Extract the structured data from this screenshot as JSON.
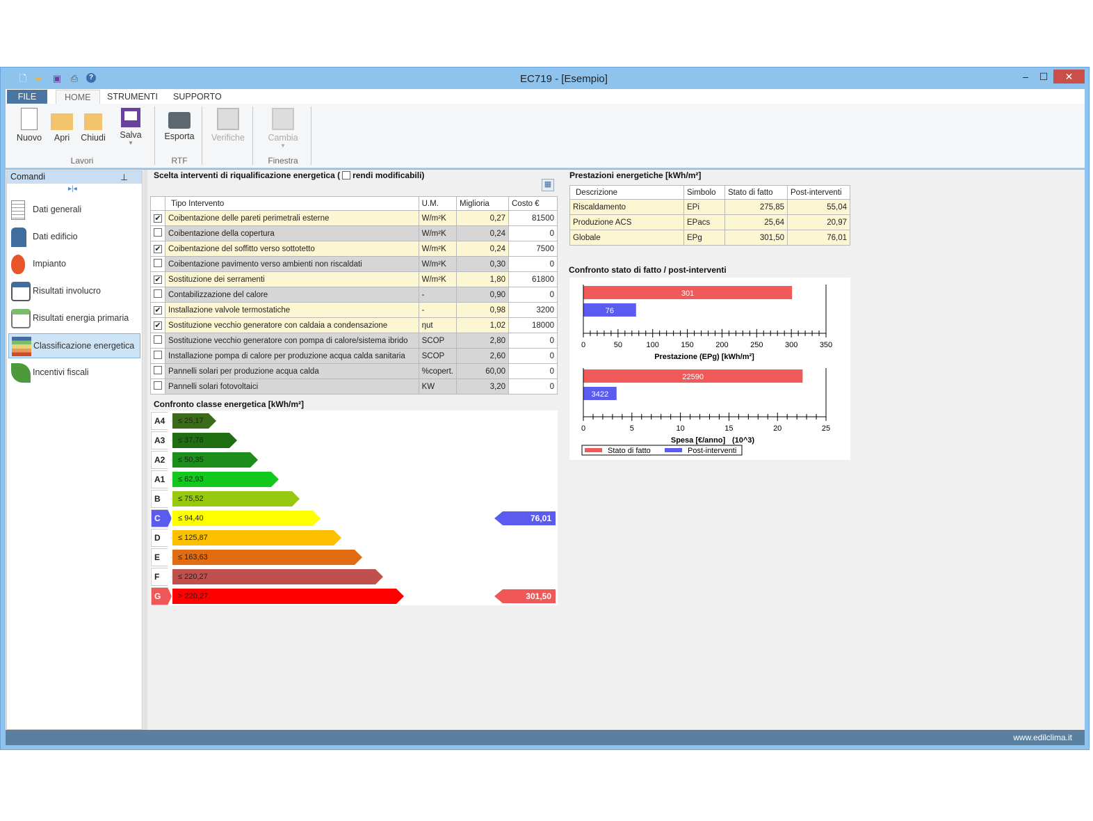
{
  "window": {
    "title": "EC719 - [Esempio]",
    "minimize": "–",
    "maximize": "☐",
    "close": "✕"
  },
  "quick_access": [
    "new-icon",
    "open-icon",
    "save-icon",
    "print-icon",
    "help-icon"
  ],
  "tabs": [
    "FILE",
    "HOME",
    "STRUMENTI",
    "SUPPORTO"
  ],
  "ribbon": {
    "buttons": [
      {
        "label": "Nuovo"
      },
      {
        "label": "Apri"
      },
      {
        "label": "Chiudi"
      },
      {
        "label": "Salva"
      },
      {
        "label": "Esporta"
      },
      {
        "label": "Verifiche"
      },
      {
        "label": "Cambia"
      }
    ],
    "groups": [
      "Lavori",
      "RTF",
      "Finestra"
    ]
  },
  "sidebar": {
    "title": "Comandi",
    "items": [
      {
        "label": "Dati generali"
      },
      {
        "label": "Dati edificio"
      },
      {
        "label": "Impianto"
      },
      {
        "label": "Risultati involucro"
      },
      {
        "label": "Risultati energia primaria"
      },
      {
        "label": "Classificazione energetica"
      },
      {
        "label": "Incentivi fiscali"
      }
    ]
  },
  "interventions": {
    "title": "Scelta interventi di riqualificazione energetica (",
    "editable_label": "rendi modificabili)",
    "columns": [
      "Tipo Intervento",
      "U.M.",
      "Miglioria",
      "Costo €"
    ],
    "rows": [
      {
        "checked": true,
        "name": "Coibentazione delle pareti perimetrali esterne",
        "um": "W/m²K",
        "miglioria": "0,27",
        "costo": "81500"
      },
      {
        "checked": false,
        "name": "Coibentazione della copertura",
        "um": "W/m²K",
        "miglioria": "0,24",
        "costo": "0"
      },
      {
        "checked": true,
        "name": "Coibentazione del soffitto verso sottotetto",
        "um": "W/m²K",
        "miglioria": "0,24",
        "costo": "7500"
      },
      {
        "checked": false,
        "name": "Coibentazione pavimento verso ambienti non riscaldati",
        "um": "W/m²K",
        "miglioria": "0,30",
        "costo": "0"
      },
      {
        "checked": true,
        "name": "Sostituzione dei serramenti",
        "um": "W/m²K",
        "miglioria": "1,80",
        "costo": "61800"
      },
      {
        "checked": false,
        "name": "Contabilizzazione del calore",
        "um": "-",
        "miglioria": "0,90",
        "costo": "0"
      },
      {
        "checked": true,
        "name": "Installazione valvole termostatiche",
        "um": "-",
        "miglioria": "0,98",
        "costo": "3200"
      },
      {
        "checked": true,
        "name": "Sostituzione vecchio generatore con caldaia a condensazione",
        "um": "ηut",
        "miglioria": "1,02",
        "costo": "18000"
      },
      {
        "checked": false,
        "name": "Sostituzione vecchio generatore con pompa di calore/sistema ibrido",
        "um": "SCOP",
        "miglioria": "2,80",
        "costo": "0"
      },
      {
        "checked": false,
        "name": "Installazione pompa di calore per produzione acqua calda sanitaria",
        "um": "SCOP",
        "miglioria": "2,60",
        "costo": "0"
      },
      {
        "checked": false,
        "name": "Pannelli solari per produzione acqua calda",
        "um": "%copert.",
        "miglioria": "60,00",
        "costo": "0"
      },
      {
        "checked": false,
        "name": "Pannelli solari fotovoltaici",
        "um": "KW",
        "miglioria": "3,20",
        "costo": "0"
      }
    ]
  },
  "energy_classes": {
    "title": "Confronto classe energetica [kWh/m²]",
    "classes": [
      {
        "label": "A4",
        "limit": "≤ 25,17",
        "color": "#3a6a1a"
      },
      {
        "label": "A3",
        "limit": "≤ 37,76",
        "color": "#1f6e12"
      },
      {
        "label": "A2",
        "limit": "≤ 50,35",
        "color": "#1c8c1a"
      },
      {
        "label": "A1",
        "limit": "≤ 62,93",
        "color": "#12c81c"
      },
      {
        "label": "B",
        "limit": "≤ 75,52",
        "color": "#95c80e"
      },
      {
        "label": "C",
        "limit": "≤ 94,40",
        "color": "#ffff00"
      },
      {
        "label": "D",
        "limit": "≤ 125,87",
        "color": "#fcc000"
      },
      {
        "label": "E",
        "limit": "≤ 163,63",
        "color": "#e26c12"
      },
      {
        "label": "F",
        "limit": "≤ 220,27",
        "color": "#c0504d"
      },
      {
        "label": "G",
        "limit": "> 220,27",
        "color": "#ff0000"
      }
    ],
    "post_value": "76,01",
    "post_class": "C",
    "post_color": "#5b5bef",
    "current_value": "301,50",
    "current_class": "G",
    "current_color": "#f05858"
  },
  "performance": {
    "title": "Prestazioni energetiche [kWh/m²]",
    "columns": [
      "Descrizione",
      "Simbolo",
      "Stato di fatto",
      "Post-interventi"
    ],
    "rows": [
      {
        "desc": "Riscaldamento",
        "sym": "EPi",
        "stato": "275,85",
        "post": "55,04"
      },
      {
        "desc": "Produzione ACS",
        "sym": "EPacs",
        "stato": "25,64",
        "post": "20,97"
      },
      {
        "desc": "Globale",
        "sym": "EPg",
        "stato": "301,50",
        "post": "76,01"
      }
    ]
  },
  "comparison_title": "Confronto stato di fatto / post-interventi",
  "chart_data": [
    {
      "type": "bar",
      "orientation": "horizontal",
      "xlabel": "Prestazione (EPg) [kWh/m²]",
      "xlim": [
        0,
        350
      ],
      "ticks": [
        0,
        50,
        100,
        150,
        200,
        250,
        300,
        350
      ],
      "minor_step": 10,
      "series": [
        {
          "name": "Stato di fatto",
          "value": 301,
          "label": "301",
          "color": "#f05a5a"
        },
        {
          "name": "Post-interventi",
          "value": 76,
          "label": "76",
          "color": "#5b5bef"
        }
      ]
    },
    {
      "type": "bar",
      "orientation": "horizontal",
      "xlabel": "Spesa [€/anno]",
      "xlabel_unit": "(10^3)",
      "xlim": [
        0,
        25
      ],
      "ticks": [
        0,
        5,
        10,
        15,
        20,
        25
      ],
      "minor_step": 1,
      "series": [
        {
          "name": "Stato di fatto",
          "value": 22.59,
          "label": "22590",
          "color": "#f05a5a"
        },
        {
          "name": "Post-interventi",
          "value": 3.422,
          "label": "3422",
          "color": "#5b5bef"
        }
      ]
    }
  ],
  "legend": [
    "Stato di fatto",
    "Post-interventi"
  ],
  "status": {
    "url": "www.edilclima.it"
  }
}
